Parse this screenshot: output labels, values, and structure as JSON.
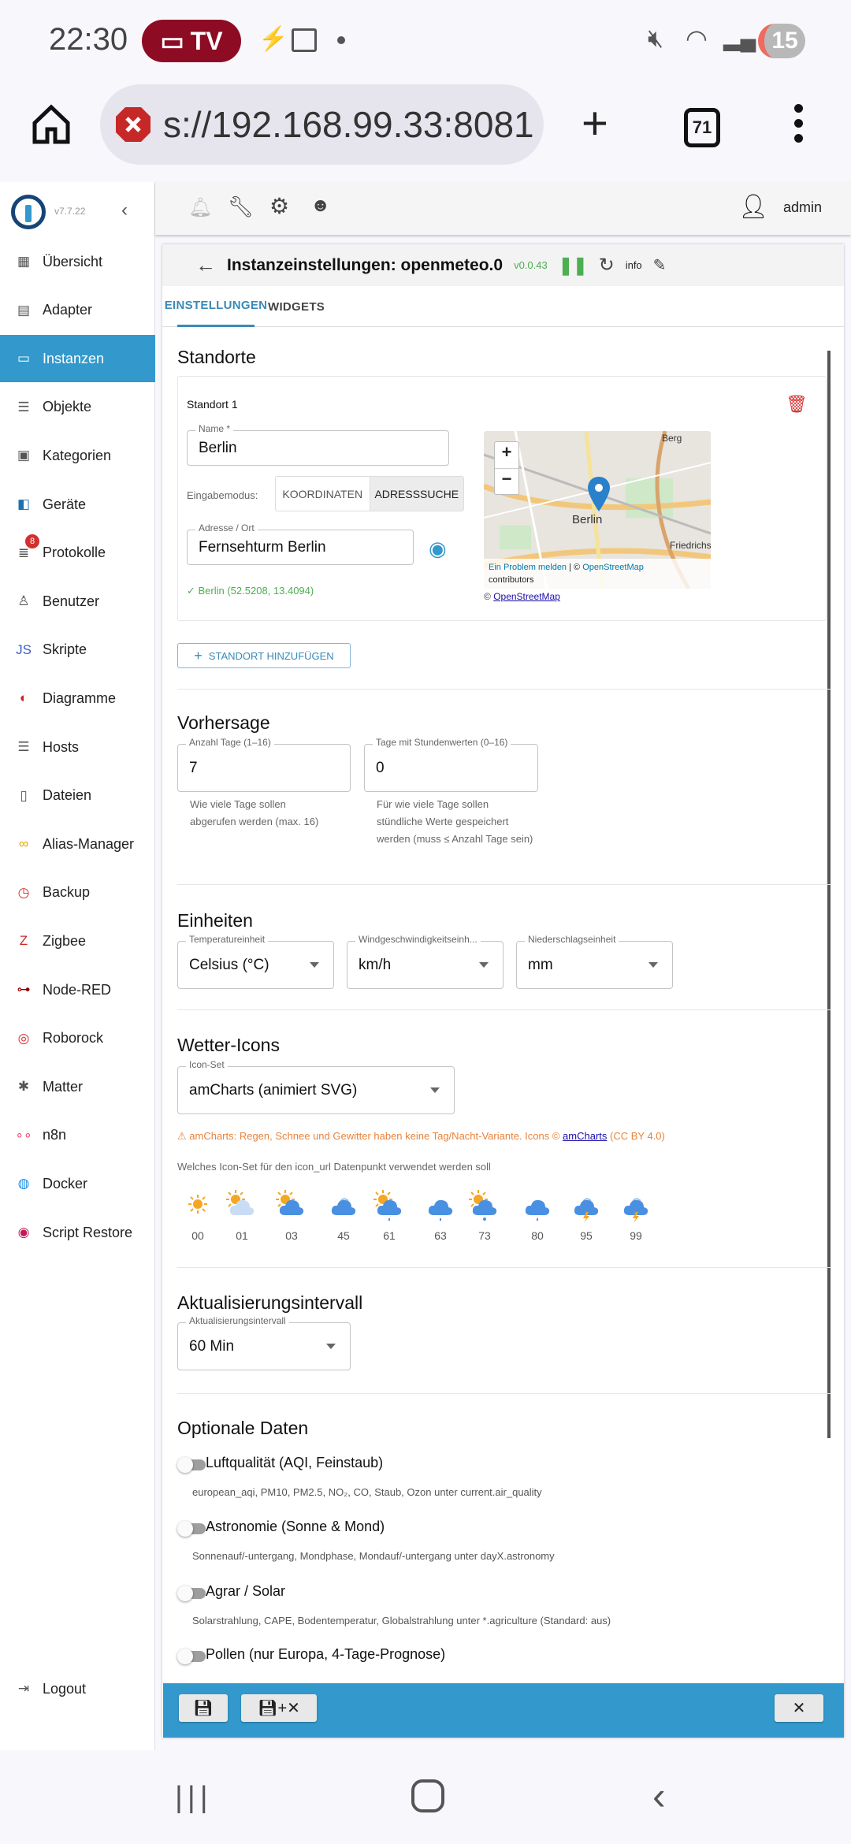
{
  "statusbar": {
    "time": "22:30",
    "tv_label": "TV",
    "battery": "15"
  },
  "browser": {
    "url": "s://192.168.99.33:8081",
    "tab_count": "71"
  },
  "app": {
    "version": "v7.7.22",
    "user": "admin"
  },
  "sidebar": {
    "items": [
      {
        "label": "Übersicht",
        "icon": "grid-icon"
      },
      {
        "label": "Adapter",
        "icon": "store-icon"
      },
      {
        "label": "Instanzen",
        "icon": "instances-icon",
        "active": true
      },
      {
        "label": "Objekte",
        "icon": "list-icon"
      },
      {
        "label": "Kategorien",
        "icon": "category-icon"
      },
      {
        "label": "Geräte",
        "icon": "devices-icon"
      },
      {
        "label": "Protokolle",
        "icon": "log-icon",
        "badge": "8"
      },
      {
        "label": "Benutzer",
        "icon": "user-icon"
      },
      {
        "label": "Skripte",
        "icon": "javascript-icon"
      },
      {
        "label": "Diagramme",
        "icon": "chart-icon"
      },
      {
        "label": "Hosts",
        "icon": "hosts-icon"
      },
      {
        "label": "Dateien",
        "icon": "files-icon"
      },
      {
        "label": "Alias-Manager",
        "icon": "alias-icon"
      },
      {
        "label": "Backup",
        "icon": "backup-icon"
      },
      {
        "label": "Zigbee",
        "icon": "zigbee-icon"
      },
      {
        "label": "Node-RED",
        "icon": "node-red-icon"
      },
      {
        "label": "Roborock",
        "icon": "roborock-icon"
      },
      {
        "label": "Matter",
        "icon": "matter-icon"
      },
      {
        "label": "n8n",
        "icon": "n8n-icon"
      },
      {
        "label": "Docker",
        "icon": "docker-icon"
      },
      {
        "label": "Script Restore",
        "icon": "script-restore-icon"
      }
    ],
    "logout": "Logout"
  },
  "instance": {
    "title": "Instanzeinstellungen: openmeteo.0",
    "version": "v0.0.43",
    "info": "info",
    "tabs": [
      "EINSTELLUNGEN",
      "WIDGETS"
    ]
  },
  "standorte": {
    "heading": "Standorte",
    "card_title": "Standort 1",
    "name_label": "Name *",
    "name_value": "Berlin",
    "mode_label": "Eingabemodus:",
    "mode_options": [
      "KOORDINATEN",
      "ADRESSSUCHE"
    ],
    "address_label": "Adresse / Ort",
    "address_value": "Fernsehturm Berlin",
    "resolved": "✓ Berlin (52.5208, 13.4094)",
    "map": {
      "report": "Ein Problem melden",
      "sep": " | © ",
      "osm": "OpenStreetMap",
      "contributors": "contributors",
      "labels": [
        "Berg",
        "Berlin",
        "Friedrichs"
      ],
      "copyright": "© ",
      "copyright_link": "OpenStreetMap"
    },
    "add_button": "STANDORT HINZUFÜGEN"
  },
  "vorhersage": {
    "heading": "Vorhersage",
    "days_label": "Anzahl Tage (1–16)",
    "days_value": "7",
    "days_help": "Wie viele Tage sollen abgerufen werden (max. 16)",
    "hourly_label": "Tage mit Stundenwerten (0–16)",
    "hourly_value": "0",
    "hourly_help": "Für wie viele Tage sollen stündliche Werte gespeichert werden (muss ≤ Anzahl Tage sein)"
  },
  "einheiten": {
    "heading": "Einheiten",
    "temp_label": "Temperatureinheit",
    "temp_value": "Celsius (°C)",
    "wind_label": "Windgeschwindigkeitseinh...",
    "wind_value": "km/h",
    "precip_label": "Niederschlagseinheit",
    "precip_value": "mm"
  },
  "icons": {
    "heading": "Wetter-Icons",
    "set_label": "Icon-Set",
    "set_value": "amCharts (animiert SVG)",
    "warning": "⚠ amCharts: Regen, Schnee und Gewitter haben keine Tag/Nacht-Variante. Icons © ",
    "warning_link": "amCharts",
    "warning_tail": " (CC BY 4.0)",
    "help": "Welches Icon-Set für den icon_url Datenpunkt verwendet werden soll",
    "preview": [
      {
        "code": "00",
        "kind": "sun"
      },
      {
        "code": "01",
        "kind": "sun-lightcloud"
      },
      {
        "code": "03",
        "kind": "sun-cloud"
      },
      {
        "code": "45",
        "kind": "fog-cloud"
      },
      {
        "code": "61",
        "kind": "sun-cloud-rain"
      },
      {
        "code": "63",
        "kind": "cloud-rain"
      },
      {
        "code": "73",
        "kind": "sun-cloud-snow"
      },
      {
        "code": "80",
        "kind": "cloud-rain"
      },
      {
        "code": "95",
        "kind": "cloud-thunder"
      },
      {
        "code": "99",
        "kind": "cloud-thunder"
      }
    ]
  },
  "intervall": {
    "heading": "Aktualisierungsintervall",
    "label": "Aktualisierungsintervall",
    "value": "60 Min"
  },
  "optional": {
    "heading": "Optionale Daten",
    "items": [
      {
        "label": "Luftqualität (AQI, Feinstaub)",
        "sub": "european_aqi, PM10, PM2.5, NO₂, CO, Staub, Ozon unter current.air_quality",
        "on": false
      },
      {
        "label": "Astronomie (Sonne & Mond)",
        "sub": "Sonnenauf/-untergang, Mondphase, Mondauf/-untergang unter dayX.astronomy",
        "on": false
      },
      {
        "label": "Agrar / Solar",
        "sub": "Solarstrahlung, CAPE, Bodentemperatur, Globalstrahlung unter *.agriculture (Standard: aus)",
        "on": false
      },
      {
        "label": "Pollen (nur Europa, 4-Tage-Prognose)",
        "on": false
      }
    ]
  },
  "colors": {
    "accent": "#3399cc",
    "danger": "#d32f2f",
    "success": "#4caf50",
    "warning": "#e8833a"
  }
}
